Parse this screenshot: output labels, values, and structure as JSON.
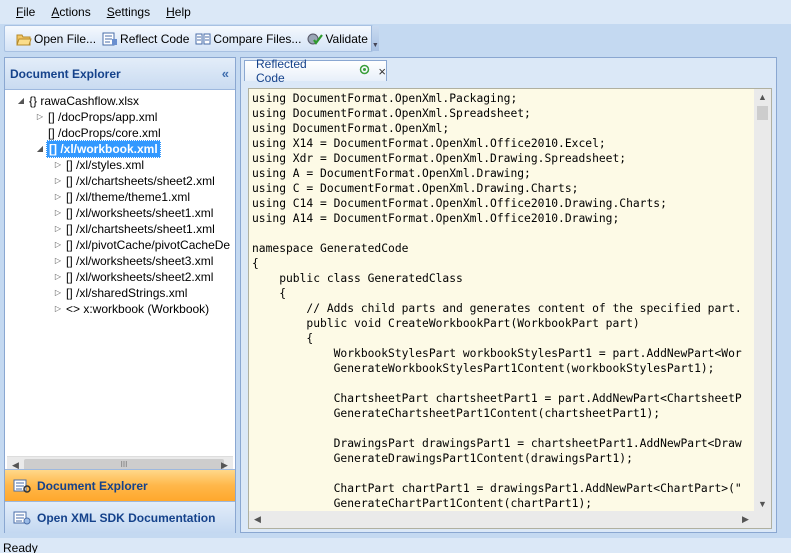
{
  "menu": [
    {
      "underline": "F",
      "rest": "ile"
    },
    {
      "underline": "A",
      "rest": "ctions"
    },
    {
      "underline": "S",
      "rest": "ettings"
    },
    {
      "underline": "H",
      "rest": "elp"
    }
  ],
  "toolbar": {
    "open_label": "Open File...",
    "reflect_label": "Reflect Code",
    "compare_label": "Compare Files...",
    "validate_label": "Validate"
  },
  "explorer": {
    "title": "Document Explorer",
    "collapse": "«",
    "tree": [
      {
        "toggle": "◢",
        "label": "{} rawaCashflow.xlsx"
      },
      {
        "toggle": "▷",
        "label": "[] /docProps/app.xml"
      },
      {
        "toggle": "",
        "label": "[] /docProps/core.xml"
      },
      {
        "toggle": "◢",
        "label": "[] /xl/workbook.xml"
      },
      {
        "toggle": "▷",
        "label": "[] /xl/styles.xml"
      },
      {
        "toggle": "▷",
        "label": "[] /xl/chartsheets/sheet2.xml"
      },
      {
        "toggle": "▷",
        "label": "[] /xl/theme/theme1.xml"
      },
      {
        "toggle": "▷",
        "label": "[] /xl/worksheets/sheet1.xml"
      },
      {
        "toggle": "▷",
        "label": "[] /xl/chartsheets/sheet1.xml"
      },
      {
        "toggle": "▷",
        "label": "[] /xl/pivotCache/pivotCacheDe"
      },
      {
        "toggle": "▷",
        "label": "[] /xl/worksheets/sheet3.xml"
      },
      {
        "toggle": "▷",
        "label": "[] /xl/worksheets/sheet2.xml"
      },
      {
        "toggle": "▷",
        "label": "[] /xl/sharedStrings.xml"
      },
      {
        "toggle": "▷",
        "label": "<> x:workbook (Workbook)"
      }
    ],
    "scroll_grip": "III"
  },
  "nav": {
    "doc_explorer": "Document Explorer",
    "sdk_docs": "Open XML SDK Documentation"
  },
  "tab": {
    "label": "Reflected Code",
    "close": "×"
  },
  "code": [
    "using DocumentFormat.OpenXml.Packaging;",
    "using DocumentFormat.OpenXml.Spreadsheet;",
    "using DocumentFormat.OpenXml;",
    "using X14 = DocumentFormat.OpenXml.Office2010.Excel;",
    "using Xdr = DocumentFormat.OpenXml.Drawing.Spreadsheet;",
    "using A = DocumentFormat.OpenXml.Drawing;",
    "using C = DocumentFormat.OpenXml.Drawing.Charts;",
    "using C14 = DocumentFormat.OpenXml.Office2010.Drawing.Charts;",
    "using A14 = DocumentFormat.OpenXml.Office2010.Drawing;",
    "",
    "namespace GeneratedCode",
    "{",
    "    public class GeneratedClass",
    "    {",
    "        // Adds child parts and generates content of the specified part.",
    "        public void CreateWorkbookPart(WorkbookPart part)",
    "        {",
    "            WorkbookStylesPart workbookStylesPart1 = part.AddNewPart<Wor",
    "            GenerateWorkbookStylesPart1Content(workbookStylesPart1);",
    "",
    "            ChartsheetPart chartsheetPart1 = part.AddNewPart<ChartsheetP",
    "            GenerateChartsheetPart1Content(chartsheetPart1);",
    "",
    "            DrawingsPart drawingsPart1 = chartsheetPart1.AddNewPart<Draw",
    "            GenerateDrawingsPart1Content(drawingsPart1);",
    "",
    "            ChartPart chartPart1 = drawingsPart1.AddNewPart<ChartPart>(\"",
    "            GenerateChartPart1Content(chartPart1);"
  ],
  "status": "Ready"
}
